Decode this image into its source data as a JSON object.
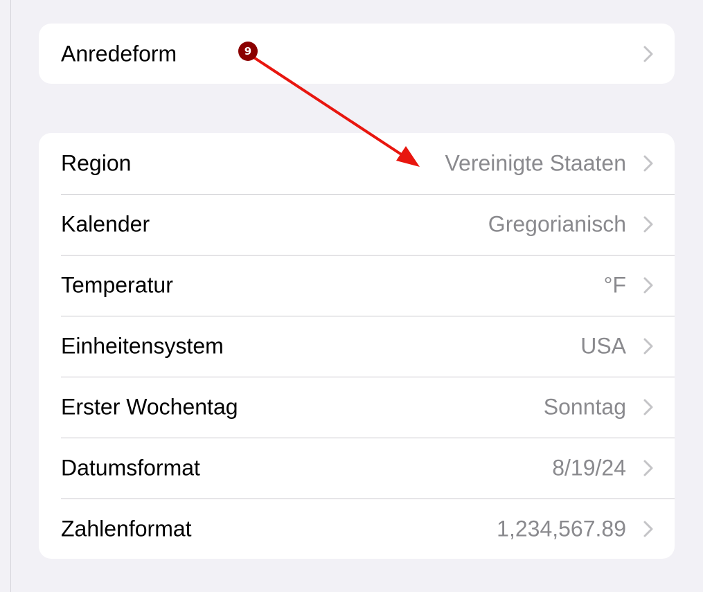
{
  "groups": [
    {
      "rows": [
        {
          "label": "Anredeform",
          "value": ""
        }
      ]
    },
    {
      "rows": [
        {
          "label": "Region",
          "value": "Vereinigte Staaten"
        },
        {
          "label": "Kalender",
          "value": "Gregorianisch"
        },
        {
          "label": "Temperatur",
          "value": "°F"
        },
        {
          "label": "Einheitensystem",
          "value": "USA"
        },
        {
          "label": "Erster Wochentag",
          "value": "Sonntag"
        },
        {
          "label": "Datumsformat",
          "value": "8/19/24"
        },
        {
          "label": "Zahlenformat",
          "value": "1,234,567.89"
        }
      ]
    }
  ],
  "annotation": {
    "step_number": "9",
    "badge_color": "#8b0000",
    "arrow_color": "#e8160f"
  },
  "colors": {
    "background": "#f2f1f6",
    "value_text": "#8a8a8e",
    "chevron": "#c4c4c7"
  },
  "icons": {
    "row_disclosure": "chevron-right-icon"
  }
}
